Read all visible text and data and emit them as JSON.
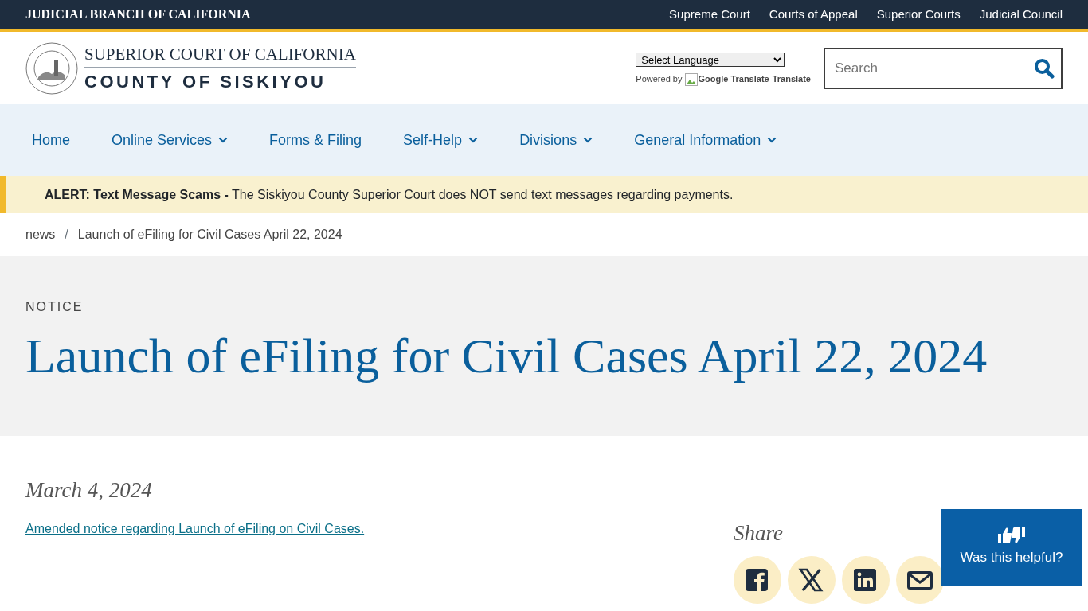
{
  "top_bar": {
    "brand": "JUDICIAL BRANCH OF CALIFORNIA",
    "links": [
      "Supreme Court",
      "Courts of Appeal",
      "Superior Courts",
      "Judicial Council"
    ]
  },
  "header": {
    "logo_line_1": "SUPERIOR COURT OF CALIFORNIA",
    "logo_line_2": "COUNTY OF SISKIYOU",
    "language_select": "Select Language",
    "powered_by": "Powered by",
    "translate_image_alt": "Google Translate",
    "translate_link": "Translate",
    "search": {
      "placeholder": "Search"
    }
  },
  "nav": [
    {
      "label": "Home",
      "dropdown": false
    },
    {
      "label": "Online Services",
      "dropdown": true
    },
    {
      "label": "Forms & Filing",
      "dropdown": false
    },
    {
      "label": "Self-Help",
      "dropdown": true
    },
    {
      "label": "Divisions",
      "dropdown": true
    },
    {
      "label": "General Information",
      "dropdown": true
    }
  ],
  "alert": {
    "text": "**ALERT: Text Message Scams -** The Siskiyou County Superior Court does NOT send text messages regarding payments."
  },
  "breadcrumb": [
    "news",
    "Launch of eFiling for Civil Cases April 22, 2024"
  ],
  "breadcrumb_separator": "/",
  "hero": {
    "eyebrow": "NOTICE",
    "title": "Launch of eFiling for Civil Cases April 22, 2024"
  },
  "article": {
    "date": "March 4, 2024",
    "link": "Amended notice regarding Launch of eFiling on Civil Cases."
  },
  "share": {
    "title": "Share",
    "buttons": [
      {
        "kind": "facebook"
      },
      {
        "kind": "x"
      },
      {
        "kind": "linkedin"
      },
      {
        "kind": "email"
      }
    ]
  },
  "feedback": {
    "label": "Was this helpful?"
  }
}
